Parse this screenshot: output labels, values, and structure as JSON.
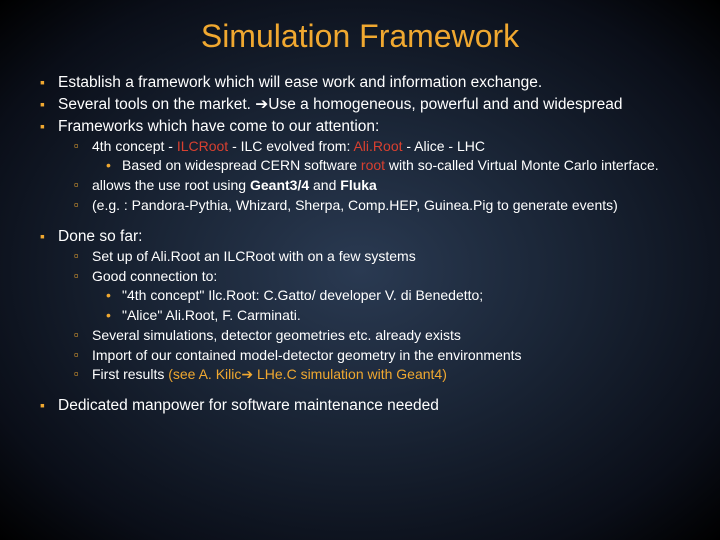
{
  "title": "Simulation Framework",
  "b1": "Establish a framework which will ease work and information exchange.",
  "b2a": "Several tools on the market.  ",
  "b2arrow": "➔",
  "b2b": "Use a homogeneous, powerful and  and widespread",
  "b3": "Frameworks which have come to our attention:",
  "b3_1a": "4th concept - ",
  "b3_1_red": "ILCRoot ",
  "b3_1b": " - ILC evolved from: ",
  "b3_1_red2": "Ali.Root",
  "b3_1c": " - Alice - LHC",
  "b3_1_1a": "Based on widespread CERN software ",
  "b3_1_1_red": "root",
  "b3_1_1b": " with so-called Virtual Monte Carlo interface.",
  "b3_2a": "allows the use root using ",
  "b3_2_bold": "Geant3/4",
  "b3_2b": " and ",
  "b3_2_bold2": "Fluka",
  "b3_3": "(e.g. : Pandora-Pythia, Whizard, Sherpa, Comp.HEP, Guinea.Pig to generate events)",
  "b4": "Done so far:",
  "b4_1": "Set up of Ali.Root an ILCRoot with on a few systems",
  "b4_2": "Good connection to:",
  "b4_2_1": "\"4th concept\" Ilc.Root: C.Gatto/ developer V. di Benedetto;",
  "b4_2_2": "\"Alice\" Ali.Root,  F. Carminati.",
  "b4_3": "Several simulations, detector geometries etc. already exists",
  "b4_4": "Import of our contained model-detector geometry in the environments",
  "b4_5a": "First results ",
  "b4_5_or": "(see A. Kilic",
  "b4_5_arrow": "➔",
  "b4_5_or2": " LHe.C simulation with Geant4)",
  "b5": "Dedicated manpower for software maintenance needed"
}
